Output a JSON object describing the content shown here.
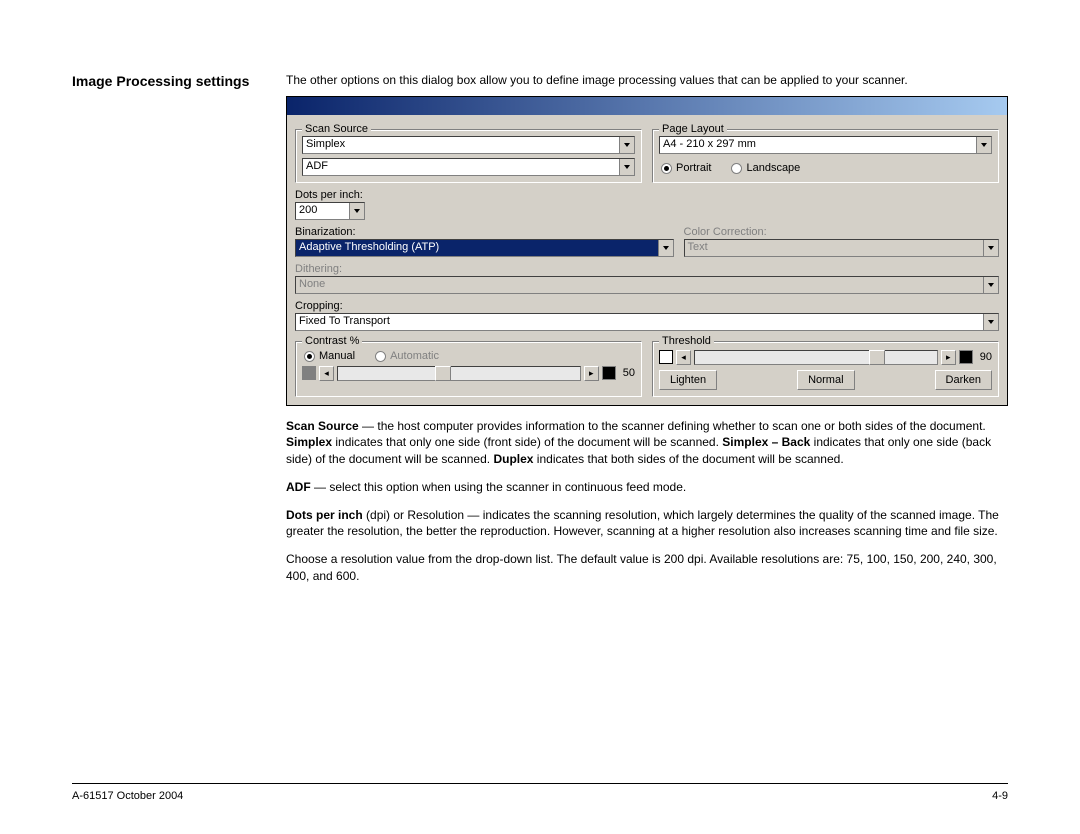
{
  "heading": "Image Processing settings",
  "intro": "The other options on this dialog box allow you to define image processing values that can be applied to your scanner.",
  "dialog": {
    "scan_source": {
      "label": "Scan Source",
      "mode": "Simplex",
      "feeder": "ADF"
    },
    "page_layout": {
      "label": "Page Layout",
      "size": "A4 - 210 x 297 mm",
      "portrait": "Portrait",
      "landscape": "Landscape"
    },
    "dpi": {
      "label": "Dots per inch:",
      "value": "200"
    },
    "binarization": {
      "label": "Binarization:",
      "value": "Adaptive Thresholding (ATP)"
    },
    "color_correction": {
      "label": "Color Correction:",
      "value": "Text"
    },
    "dithering": {
      "label": "Dithering:",
      "value": "None"
    },
    "cropping": {
      "label": "Cropping:",
      "value": "Fixed To Transport"
    },
    "contrast": {
      "label": "Contrast %",
      "manual": "Manual",
      "automatic": "Automatic",
      "value": "50"
    },
    "threshold": {
      "label": "Threshold",
      "value": "90",
      "lighten": "Lighten",
      "normal": "Normal",
      "darken": "Darken"
    }
  },
  "para_scan_source": {
    "b1": "Scan Source",
    "t1": " — the host computer provides information to the scanner defining whether to scan one or both sides of the document. ",
    "b2": "Simplex",
    "t2": " indicates that only one side (front side) of the document will be scanned. ",
    "b3": "Simplex – Back",
    "t3": " indicates that only one side (back side) of the document will be scanned. ",
    "b4": "Duplex",
    "t4": " indicates that both sides of the document will be scanned."
  },
  "para_adf": {
    "b1": "ADF",
    "t1": " — select this option when using the scanner in continuous feed mode."
  },
  "para_dpi": {
    "b1": "Dots per inch",
    "t1": " (dpi) or Resolution — indicates the scanning resolution, which largely determines the quality of the scanned image. The greater the resolution, the better the reproduction. However, scanning at a higher resolution also increases scanning time and file size."
  },
  "para_res": "Choose a resolution value from the drop-down list. The default value is 200 dpi. Available resolutions are: 75, 100, 150, 200, 240, 300, 400, and 600.",
  "footer": {
    "left": "A-61517 October 2004",
    "right": "4-9"
  }
}
